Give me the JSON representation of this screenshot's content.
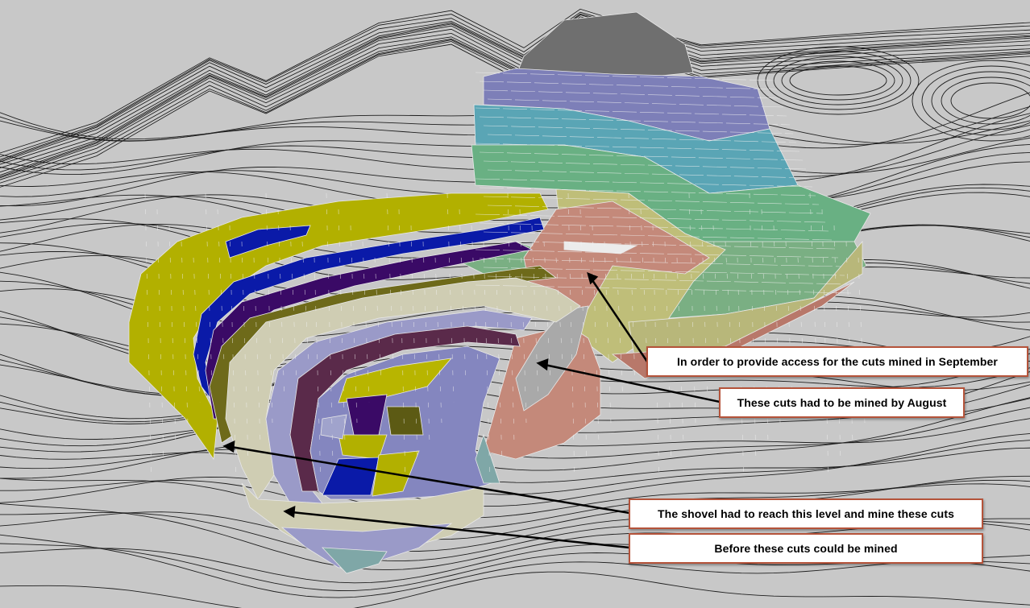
{
  "annotations": [
    "In order to provide access for the cuts mined in September",
    "These cuts had to be mined by August",
    "The shovel had to reach this level and mine these cuts",
    "Before these cuts could be mined"
  ],
  "colors": {
    "background": "#c8c8c8",
    "contour": "#1a1a1a",
    "callout_border": "#b5533a",
    "period_grey": "#6f6f6f",
    "period_blue": "#7d7fb8",
    "period_teal": "#5aa5b5",
    "period_green": "#69b083",
    "period_olive": "#bfbe79",
    "period_salmon": "#c4897a",
    "period_yellow": "#b2b000",
    "period_navy": "#0a1aa8",
    "period_purple": "#3a0a66",
    "period_beige": "#cfcdb3",
    "period_lavender": "#9a9ac8"
  }
}
